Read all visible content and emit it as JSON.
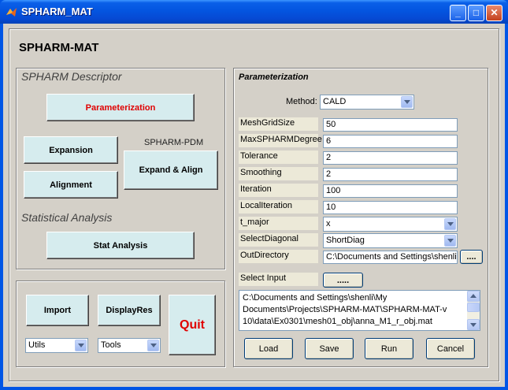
{
  "window": {
    "title": "SPHARM_MAT",
    "minimize_glyph": "_",
    "maximize_glyph": "□",
    "close_glyph": "✕"
  },
  "app": {
    "title": "SPHARM-MAT"
  },
  "descriptor": {
    "title": "SPHARM Descriptor",
    "parameterization": "Parameterization",
    "expansion": "Expansion",
    "alignment": "Alignment",
    "pdm_label": "SPHARM-PDM",
    "expand_align": "Expand & Align",
    "stat_title": "Statistical Analysis",
    "stat_analysis": "Stat Analysis"
  },
  "io": {
    "import": "Import",
    "displayres": "DisplayRes",
    "quit": "Quit",
    "utils": "Utils",
    "tools": "Tools"
  },
  "params": {
    "title": "Parameterization",
    "method_label": "Method:",
    "method_value": "CALD",
    "rows": [
      {
        "label": "MeshGridSize",
        "value": "50"
      },
      {
        "label": "MaxSPHARMDegree",
        "value": "6"
      },
      {
        "label": "Tolerance",
        "value": "2"
      },
      {
        "label": "Smoothing",
        "value": "2"
      },
      {
        "label": "Iteration",
        "value": "100"
      },
      {
        "label": "LocalIteration",
        "value": "10"
      },
      {
        "label": "t_major",
        "value": "x"
      },
      {
        "label": "SelectDiagonal",
        "value": "ShortDiag"
      },
      {
        "label": "OutDirectory",
        "value": "C:\\Documents and Settings\\shenli\\"
      }
    ],
    "browse_out": "....",
    "select_input_label": "Select Input",
    "browse_in": ".....",
    "input_lines": [
      "C:\\Documents and Settings\\shenli\\My",
      "Documents\\Projects\\SPHARM-MAT\\SPHARM-MAT-v",
      "10\\data\\Ex0301\\mesh01_obj\\anna_M1_r_obj.mat"
    ],
    "load": "Load",
    "save": "Save",
    "run": "Run",
    "cancel": "Cancel"
  },
  "colors": {
    "accent_red": "#e00000",
    "button_face": "#d6ecee",
    "panel_bg": "#d4d0c8",
    "titlebar_blue": "#0055e5"
  }
}
